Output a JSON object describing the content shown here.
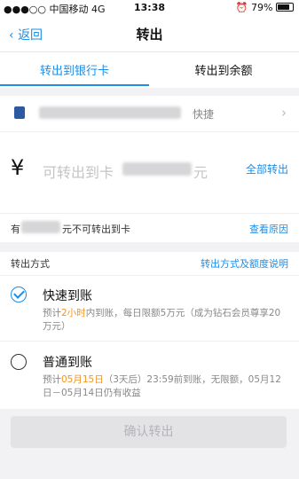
{
  "status_bar": {
    "carrier": "●●●○○ 中国移动  4G",
    "time": "13:38",
    "battery_pct": "79%"
  },
  "nav": {
    "back_label": "返回",
    "title": "转出"
  },
  "tabs": [
    {
      "label": "转出到银行卡",
      "active": true
    },
    {
      "label": "转出到余额",
      "active": false
    }
  ],
  "bank": {
    "tag": "快捷"
  },
  "amount": {
    "currency_symbol": "¥",
    "placeholder_prefix": "可转出到卡",
    "placeholder_suffix": "元",
    "all_out_label": "全部转出"
  },
  "notice": {
    "prefix": "有",
    "suffix": "元不可转出到卡",
    "reason_link": "查看原因"
  },
  "method": {
    "header_label": "转出方式",
    "header_link": "转出方式及额度说明",
    "options": [
      {
        "title": "快速到账",
        "selected": true,
        "desc_pre": "预计",
        "desc_highlight": "2小时",
        "desc_post": "内到账，每日限额5万元（成为钻石会员尊享20万元）"
      },
      {
        "title": "普通到账",
        "selected": false,
        "desc_pre": "预计",
        "desc_highlight": "05月15日",
        "desc_post": "（3天后）23:59前到账，无限额，05月12日－05月14日仍有收益"
      }
    ]
  },
  "confirm_label": "确认转出",
  "colors": {
    "accent": "#1a8ee8",
    "highlight": "#f39321"
  }
}
